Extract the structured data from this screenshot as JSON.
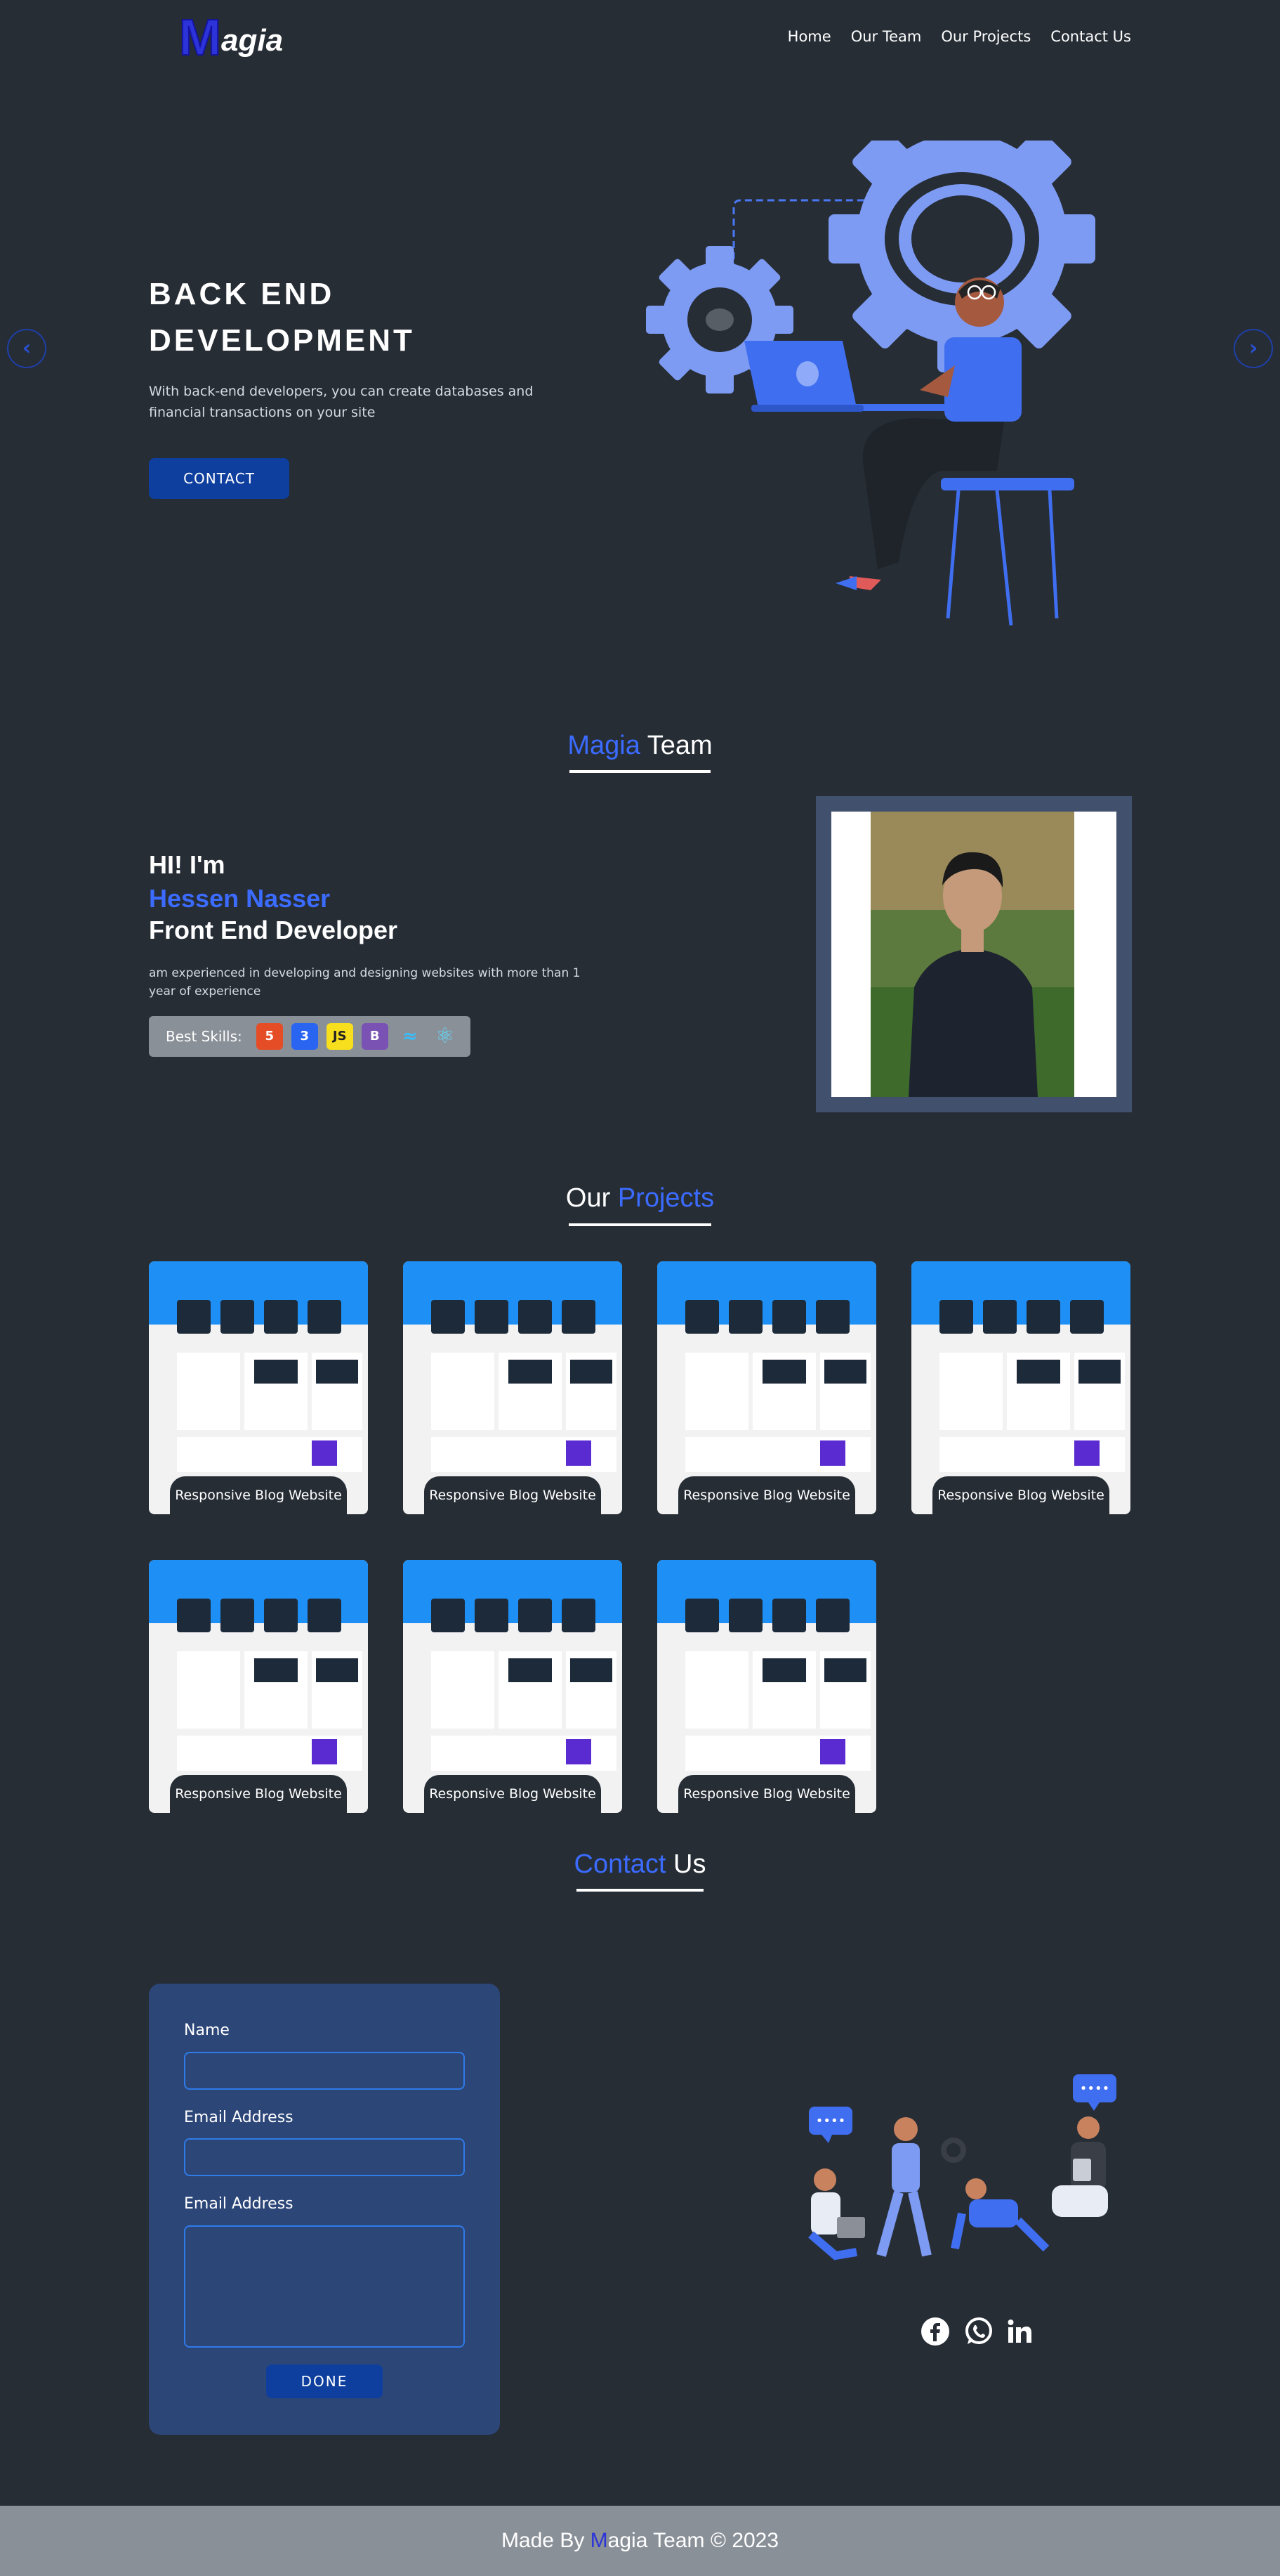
{
  "brand": {
    "logo_first": "M",
    "logo_rest": "agia"
  },
  "nav": {
    "items": [
      "Home",
      "Our Team",
      "Our Projects",
      "Contact Us"
    ]
  },
  "hero": {
    "title_line1": "BACK END",
    "title_line2": "DEVELOPMENT",
    "description": "With back-end developers, you can create databases and financial transactions on your site",
    "button_label": "CONTACT",
    "prev_icon": "chevron-left-icon",
    "next_icon": "chevron-right-icon"
  },
  "team_section": {
    "title_accent": "Magia",
    "title_rest": " Team"
  },
  "member": {
    "greeting": "HI! I'm",
    "name": "Hessen Nasser",
    "role": "Front End Developer",
    "description": "am experienced in developing and designing websites with more than 1 year of experience",
    "skills_label": "Best Skills:",
    "skills": [
      {
        "name": "html5-icon",
        "glyph": "5",
        "color": "#e44d26"
      },
      {
        "name": "css3-icon",
        "glyph": "3",
        "color": "#2965f1"
      },
      {
        "name": "javascript-icon",
        "glyph": "JS",
        "color": "#f7df1e"
      },
      {
        "name": "bootstrap-icon",
        "glyph": "B",
        "color": "#7952b3"
      },
      {
        "name": "tailwind-icon",
        "glyph": "≈",
        "color": "#38bdf8"
      },
      {
        "name": "react-icon",
        "glyph": "⚛",
        "color": "#61dafb"
      }
    ]
  },
  "projects_section": {
    "title_rest": "Our ",
    "title_accent": "Projects"
  },
  "projects": [
    {
      "caption": "Responsive Blog Website"
    },
    {
      "caption": "Responsive Blog Website"
    },
    {
      "caption": "Responsive Blog Website"
    },
    {
      "caption": "Responsive Blog Website"
    },
    {
      "caption": "Responsive Blog Website"
    },
    {
      "caption": "Responsive Blog Website"
    },
    {
      "caption": "Responsive Blog Website"
    }
  ],
  "contact_section": {
    "title_accent": "Contact",
    "title_rest": " Us"
  },
  "form": {
    "name_label": "Name",
    "email_label": "Email Address",
    "message_label": "Email Address",
    "button_label": "DONE"
  },
  "social": [
    "facebook-icon",
    "whatsapp-icon",
    "linkedin-icon"
  ],
  "footer": {
    "prefix": "Made By ",
    "brand_m": "M",
    "suffix": "agia Team © 2023"
  },
  "colors": {
    "background": "#262d35",
    "accent": "#3b6bff",
    "button": "#0e3f9e",
    "form_bg": "#2c4678",
    "footer_bg": "#8a9098"
  }
}
